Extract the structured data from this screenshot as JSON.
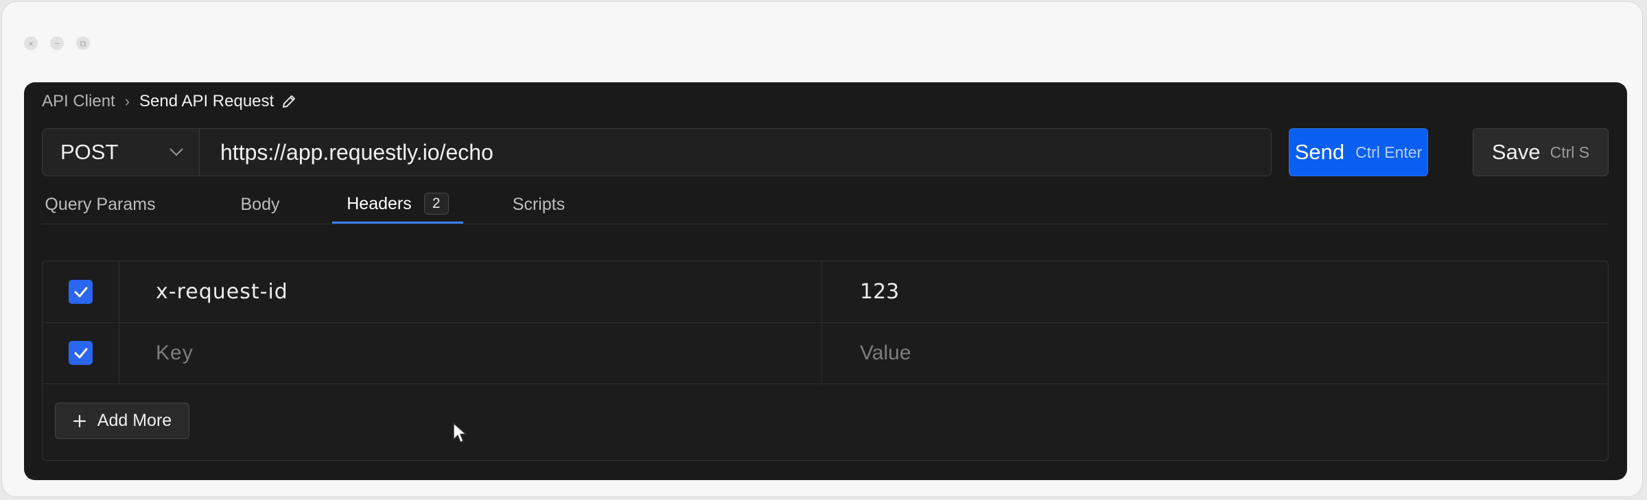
{
  "breadcrumb": {
    "root": "API Client",
    "separator": "›",
    "current": "Send API Request"
  },
  "request": {
    "method": "POST",
    "url": "https://app.requestly.io/echo"
  },
  "actions": {
    "send_label": "Send",
    "send_shortcut": "Ctrl Enter",
    "save_label": "Save",
    "save_shortcut": "Ctrl S"
  },
  "tabs": [
    {
      "label": "Query Params"
    },
    {
      "label": "Body"
    },
    {
      "label": "Headers",
      "badge": "2",
      "active": true
    },
    {
      "label": "Scripts"
    }
  ],
  "headers": {
    "rows": [
      {
        "enabled": true,
        "key": "x-request-id",
        "value": "123"
      },
      {
        "enabled": true,
        "key_placeholder": "Key",
        "value_placeholder": "Value"
      }
    ],
    "add_more_label": "Add More"
  },
  "colors": {
    "accent": "#0a5ff0",
    "panel_bg": "#1a1a1a",
    "checkbox": "#2a66f0"
  }
}
